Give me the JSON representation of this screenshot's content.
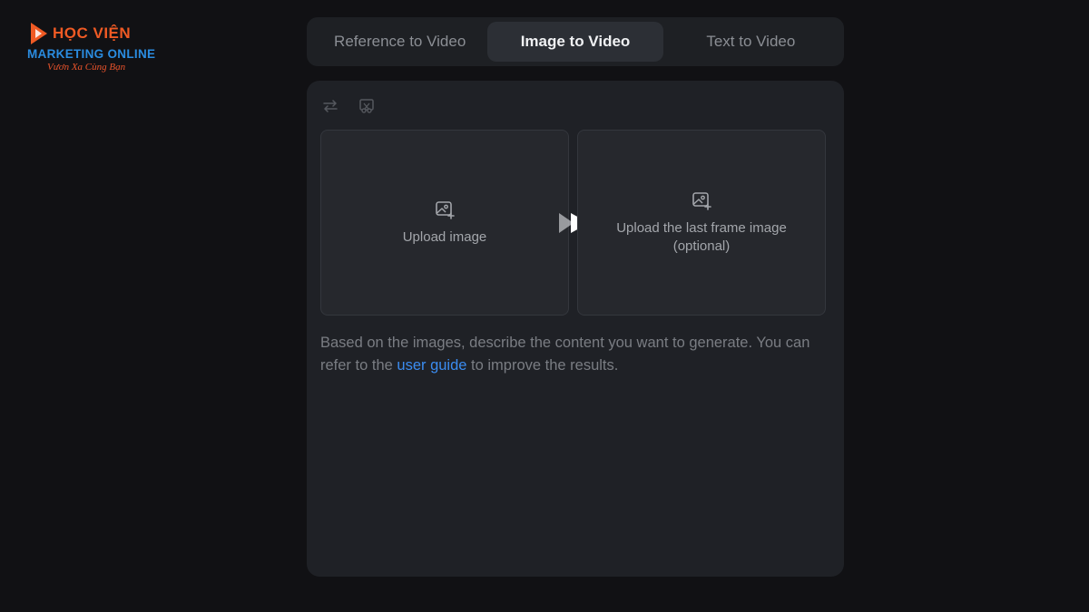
{
  "brand": {
    "line1": "HỌC VIỆN",
    "line2": "MARKETING ONLINE",
    "line3": "Vươn Xa Cùng Bạn",
    "colors": {
      "orange": "#ef5a24",
      "blue": "#2a8ce0"
    }
  },
  "tabs": [
    {
      "label": "Reference to Video",
      "active": false
    },
    {
      "label": "Image to Video",
      "active": true
    },
    {
      "label": "Text to Video",
      "active": false
    }
  ],
  "toolbar": {
    "icons": [
      "swap-arrows-icon",
      "crop-icon"
    ]
  },
  "upload": {
    "first_label": "Upload image",
    "last_label_line1": "Upload the last frame image",
    "last_label_line2": "(optional)",
    "icon": "image-add-icon",
    "between_icon": "play-arrow-icon"
  },
  "prompt": {
    "text_before": "Based on the images, describe the content you want to generate. You can refer to the ",
    "link": "user guide",
    "text_after": " to improve the results."
  },
  "colors": {
    "background": "#111114",
    "panel": "#1f2126",
    "tab_active": "#2c2f35",
    "link": "#3b8cf0"
  }
}
